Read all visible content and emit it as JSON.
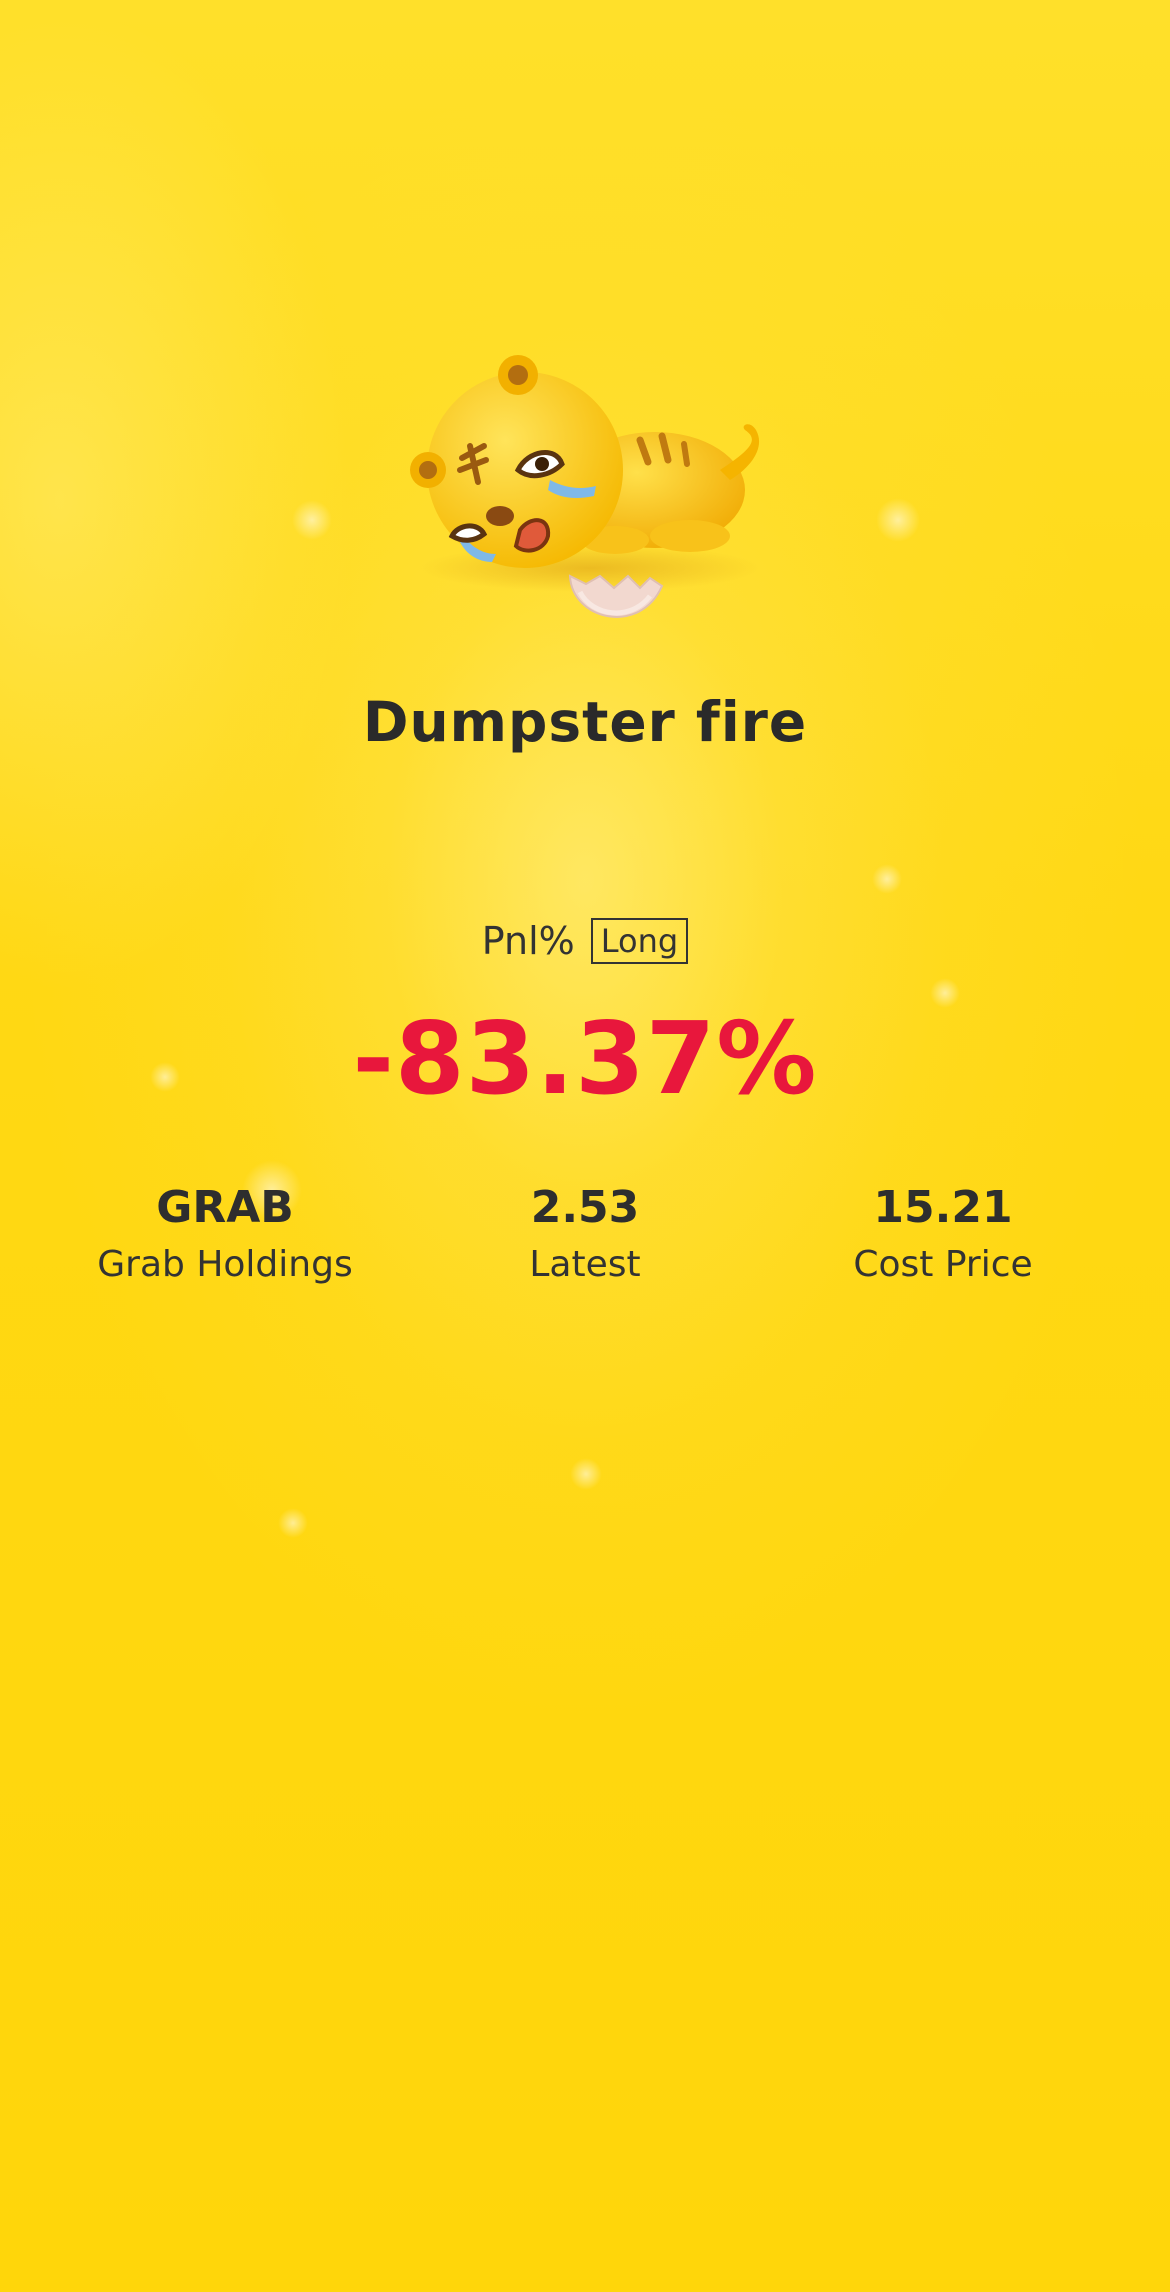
{
  "title": "Dumpster fire",
  "pnl": {
    "label": "Pnl%",
    "direction": "Long",
    "value": "-83.37%",
    "value_color": "#e8173c"
  },
  "stats": [
    {
      "value": "GRAB",
      "label": "Grab Holdings"
    },
    {
      "value": "2.53",
      "label": "Latest"
    },
    {
      "value": "15.21",
      "label": "Cost Price"
    }
  ],
  "mascot": {
    "icon": "crying-tiger-mascot-icon",
    "accessory": "broken-eggshell-icon"
  },
  "colors": {
    "background": "#ffd80c",
    "text": "#2a2a2a",
    "loss": "#e8173c"
  }
}
